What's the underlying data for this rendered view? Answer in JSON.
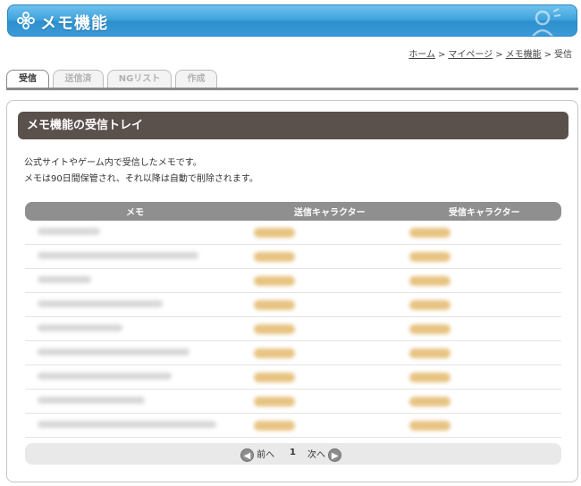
{
  "header": {
    "title": "メモ機能"
  },
  "breadcrumb": {
    "items": [
      "ホーム",
      "マイページ",
      "メモ機能"
    ],
    "current": "受信",
    "separator": ">"
  },
  "tabs": [
    {
      "label": "受信",
      "active": true
    },
    {
      "label": "送信済",
      "active": false
    },
    {
      "label": "NGリスト",
      "active": false
    },
    {
      "label": "作成",
      "active": false
    }
  ],
  "panel": {
    "title": "メモ機能の受信トレイ",
    "desc_line1": "公式サイトやゲーム内で受信したメモです。",
    "desc_line2": "メモは90日間保管され、それ以降は自動で削除されます。"
  },
  "table": {
    "columns": [
      "メモ",
      "送信キャラクター",
      "受信キャラクター"
    ],
    "rows": [
      {
        "memo": "",
        "sender": "",
        "receiver": ""
      },
      {
        "memo": "",
        "sender": "",
        "receiver": ""
      },
      {
        "memo": "",
        "sender": "",
        "receiver": ""
      },
      {
        "memo": "",
        "sender": "",
        "receiver": ""
      },
      {
        "memo": "",
        "sender": "",
        "receiver": ""
      },
      {
        "memo": "",
        "sender": "",
        "receiver": ""
      },
      {
        "memo": "",
        "sender": "",
        "receiver": ""
      },
      {
        "memo": "",
        "sender": "",
        "receiver": ""
      },
      {
        "memo": "",
        "sender": "",
        "receiver": ""
      }
    ]
  },
  "pager": {
    "prev": "前へ",
    "page": "1",
    "next": "次へ"
  },
  "colors": {
    "header": "#3ea2dc",
    "panel_title": "#5a504c",
    "table_header": "#8f8f8f",
    "name_badge": "#e8c483"
  },
  "icons": {
    "logo": "gear-flower-icon",
    "person": "person-icon",
    "prev": "left-arrow-icon",
    "next": "right-arrow-icon"
  }
}
